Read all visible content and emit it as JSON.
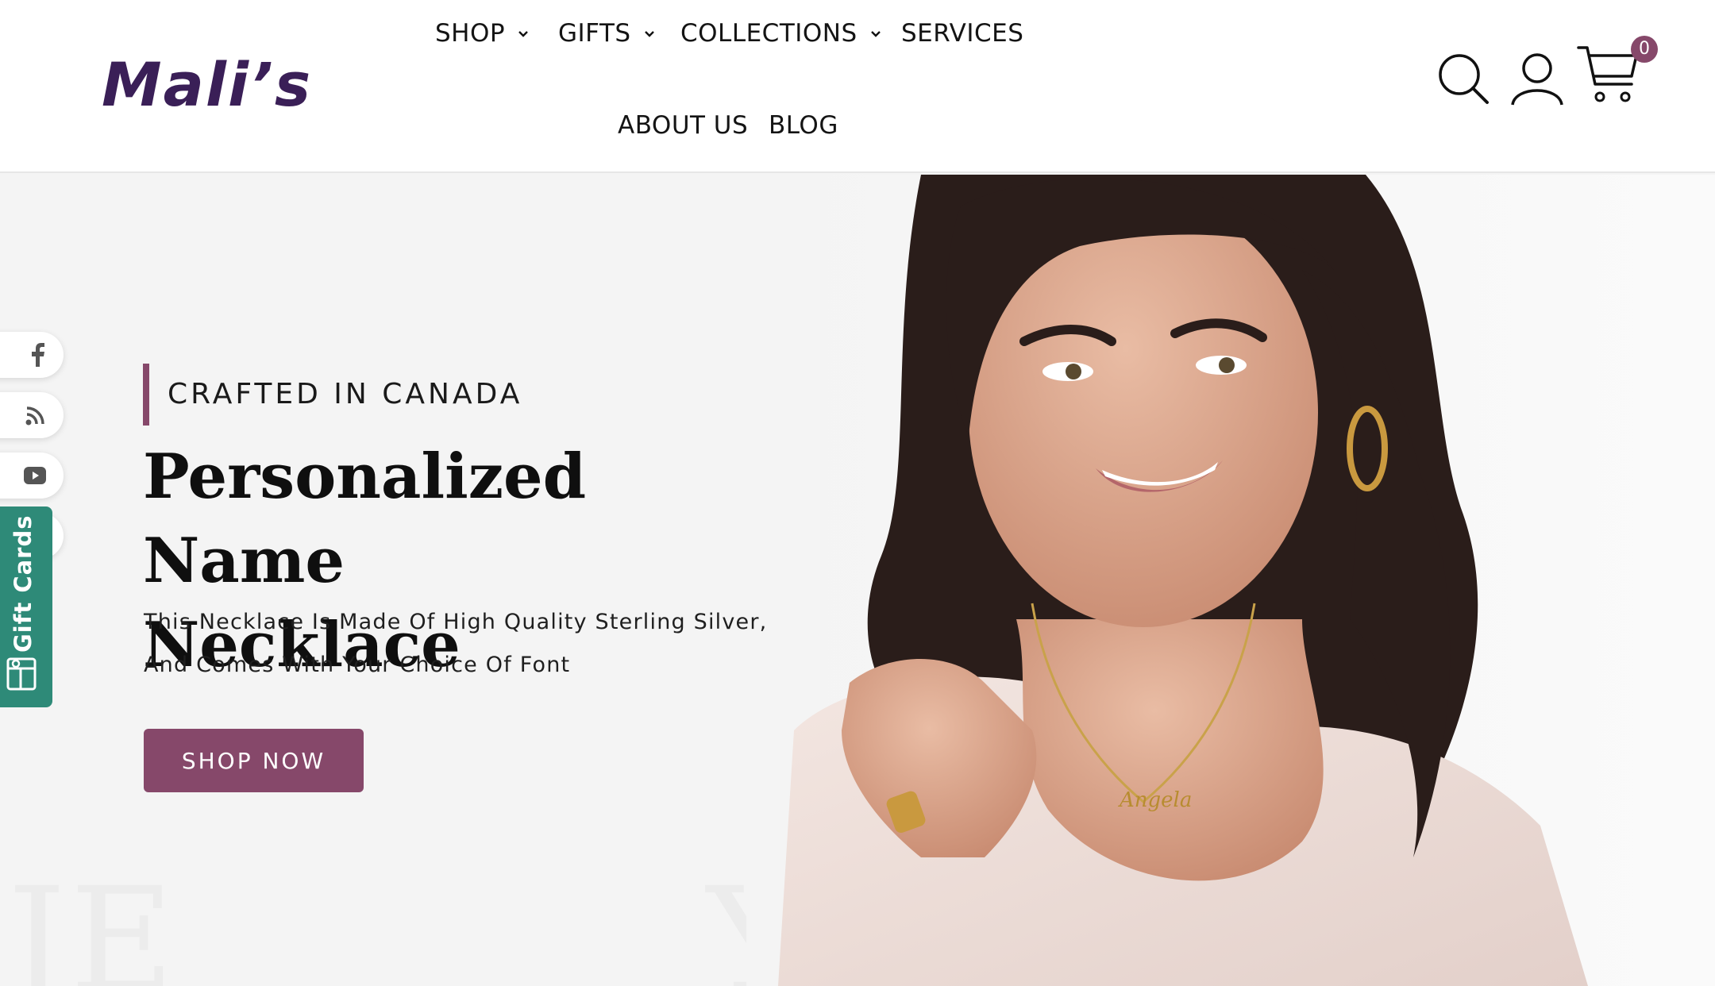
{
  "brand": {
    "logo_text": "Mali’s",
    "accent_color": "#86486a",
    "logo_color": "#3a1f57"
  },
  "nav": {
    "shop": "SHOP",
    "gifts": "GIFTS",
    "collections": "COLLECTIONS",
    "services": "SERVICES",
    "about": "ABOUT US",
    "blog": "BLOG"
  },
  "header_icons": {
    "search": "search-icon",
    "account": "user-icon",
    "cart": "cart-icon",
    "cart_count": "0"
  },
  "hero": {
    "eyebrow": "CRAFTED IN CANADA",
    "title_line1": "Personalized Name",
    "title_line2": "Necklace",
    "desc_line1": "This Necklace Is Made Of High Quality Sterling Silver,",
    "desc_line2": "And Comes With Your Choice Of Font",
    "cta": "SHOP NOW",
    "necklace_name": "Angela"
  },
  "social": [
    "facebook-icon",
    "rss-icon",
    "youtube-icon"
  ],
  "gift_tab": {
    "label": "Gift Cards",
    "color": "#2e8a78"
  }
}
